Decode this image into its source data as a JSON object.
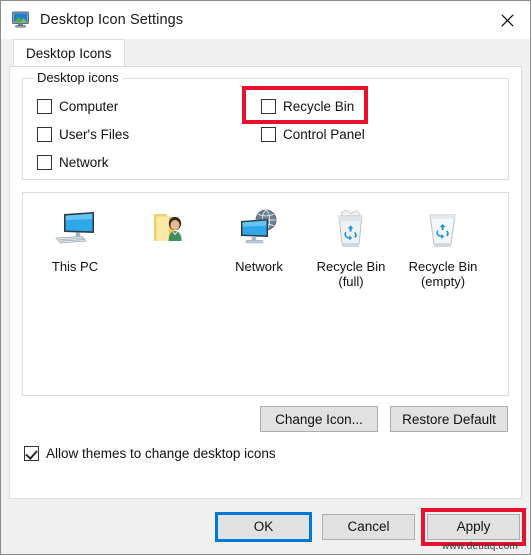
{
  "window": {
    "title": "Desktop Icon Settings",
    "title_icon": "desktop-monitor-icon",
    "close_icon": "close-icon"
  },
  "tabs": [
    {
      "label": "Desktop Icons",
      "selected": true
    }
  ],
  "group": {
    "legend": "Desktop icons",
    "checkboxes": [
      {
        "label": "Computer",
        "checked": false,
        "column": "left",
        "name": "checkbox-computer"
      },
      {
        "label": "Recycle Bin",
        "checked": false,
        "column": "right",
        "name": "checkbox-recycle-bin",
        "highlighted": true
      },
      {
        "label": "User's Files",
        "checked": false,
        "column": "left",
        "name": "checkbox-users-files"
      },
      {
        "label": "Control Panel",
        "checked": false,
        "column": "right",
        "name": "checkbox-control-panel"
      },
      {
        "label": "Network",
        "checked": false,
        "column": "left",
        "name": "checkbox-network"
      }
    ]
  },
  "preview": {
    "icons": [
      {
        "label": "This PC",
        "sublabel": "",
        "icon": "this-pc-icon"
      },
      {
        "label": "",
        "sublabel": "",
        "icon": "users-files-folder-icon"
      },
      {
        "label": "Network",
        "sublabel": "",
        "icon": "network-globe-icon"
      },
      {
        "label": "Recycle Bin",
        "sublabel": "(full)",
        "icon": "recycle-bin-full-icon"
      },
      {
        "label": "Recycle Bin",
        "sublabel": "(empty)",
        "icon": "recycle-bin-empty-icon"
      }
    ]
  },
  "actions": {
    "change_icon": "Change Icon...",
    "restore_default": "Restore Default"
  },
  "allow_themes": {
    "label": "Allow themes to change desktop icons",
    "checked": true
  },
  "footer": {
    "ok": "OK",
    "cancel": "Cancel",
    "apply": "Apply",
    "focused_button": "OK",
    "highlighted_button": "Apply"
  },
  "watermark": "www.deuaq.com",
  "colors": {
    "annotation_red": "#e8112d",
    "focus_blue": "#0078d7",
    "window_bg": "#f0f0f0",
    "panel_bg": "#ffffff"
  }
}
